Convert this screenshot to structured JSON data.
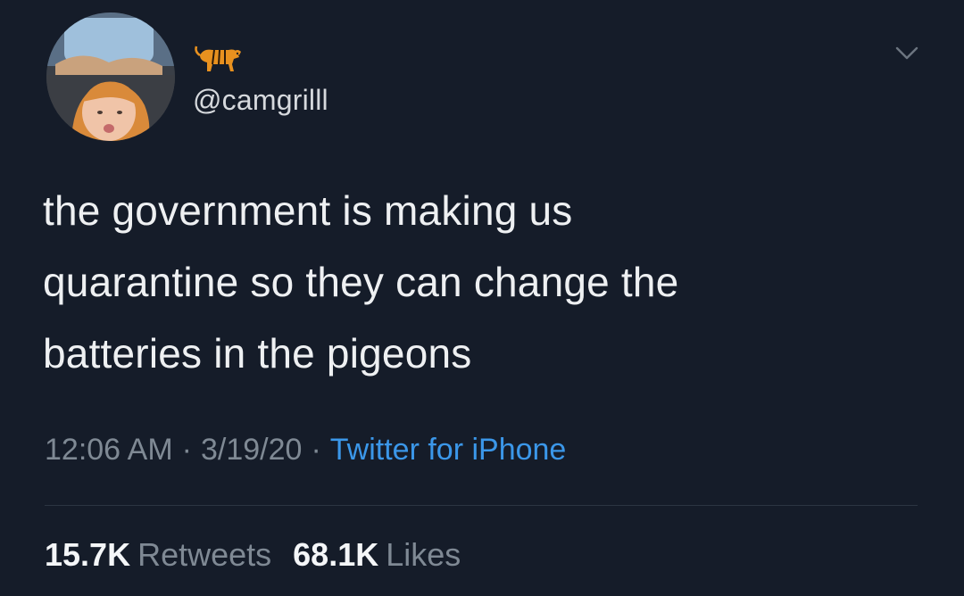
{
  "user": {
    "display_name_emoji": "tiger-emoji",
    "handle": "@camgrilll"
  },
  "tweet": {
    "lines": [
      "the government is making us",
      "quarantine so they can change the",
      "batteries in the pigeons"
    ]
  },
  "meta": {
    "time": "12:06 AM",
    "date": "3/19/20",
    "separator": "·",
    "source": "Twitter for iPhone"
  },
  "stats": {
    "retweets": {
      "count": "15.7K",
      "label": "Retweets"
    },
    "likes": {
      "count": "68.1K",
      "label": "Likes"
    }
  },
  "colors": {
    "background": "#151c29",
    "text": "#eef0f2",
    "secondary": "#7f8994",
    "link": "#3b97e9",
    "divider": "#2c3542"
  },
  "icons": {
    "menu": "chevron-down-icon",
    "display_name": "tiger-icon"
  }
}
